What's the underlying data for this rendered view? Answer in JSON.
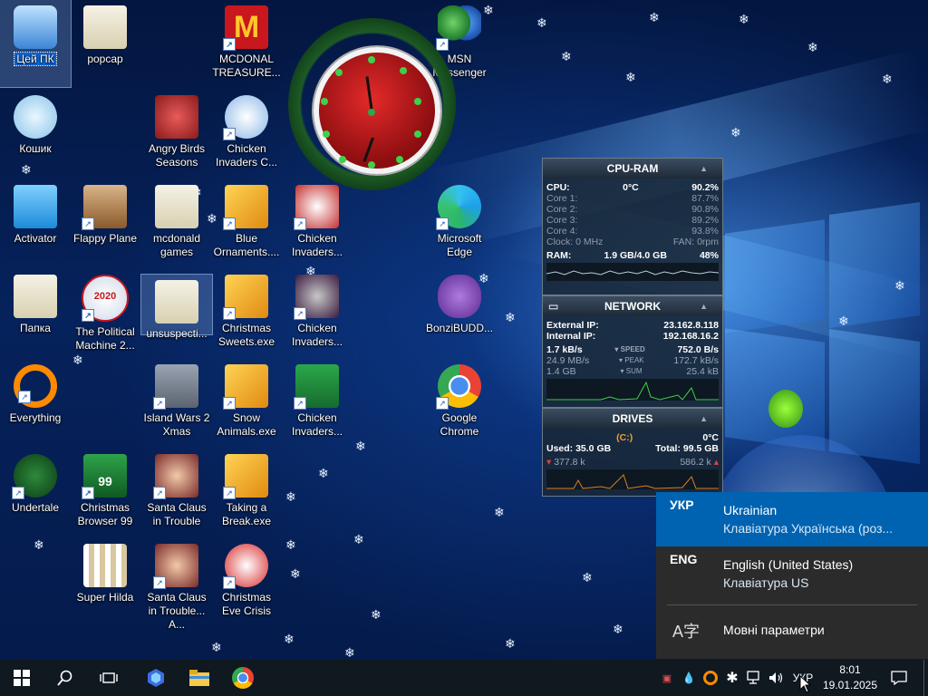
{
  "desktop": {
    "icons": [
      {
        "label": "Цей ПК"
      },
      {
        "label": "popcap"
      },
      {
        "label": "MCDONAL TREASURE..."
      },
      {
        "label": "MSN Messenger"
      },
      {
        "label": "Кошик"
      },
      {
        "label": "Angry Birds Seasons"
      },
      {
        "label": "Chicken Invaders C..."
      },
      {
        "label": "Activator"
      },
      {
        "label": "Flappy Plane"
      },
      {
        "label": "mcdonald games"
      },
      {
        "label": "Blue Ornaments...."
      },
      {
        "label": "Chicken Invaders..."
      },
      {
        "label": "Microsoft Edge"
      },
      {
        "label": "Папка"
      },
      {
        "label": "The Political Machine 2..."
      },
      {
        "label": "unsuspecti..."
      },
      {
        "label": "Christmas Sweets.exe"
      },
      {
        "label": "Chicken Invaders..."
      },
      {
        "label": "BonziBUDD..."
      },
      {
        "label": "Everything"
      },
      {
        "label": "Island Wars 2 Xmas"
      },
      {
        "label": "Snow Animals.exe"
      },
      {
        "label": "Chicken Invaders..."
      },
      {
        "label": "Google Chrome"
      },
      {
        "label": "Undertale"
      },
      {
        "label": "Christmas Browser 99"
      },
      {
        "label": "Santa Claus in Trouble"
      },
      {
        "label": "Taking a Break.exe"
      },
      {
        "label": "Super Hilda"
      },
      {
        "label": "Santa Claus in Trouble... A..."
      },
      {
        "label": "Christmas Eve Crisis"
      }
    ],
    "icon_badges": {
      "political": "2020",
      "browser99": "99"
    }
  },
  "cpu_ram": {
    "title": "CPU-RAM",
    "cpu_label": "CPU:",
    "cpu_temp": "0°C",
    "cpu_value": "90.2%",
    "cores": [
      {
        "label": "Core 1:",
        "value": "87.7%"
      },
      {
        "label": "Core 2:",
        "value": "90.8%"
      },
      {
        "label": "Core 3:",
        "value": "89.2%"
      },
      {
        "label": "Core 4:",
        "value": "93.8%"
      }
    ],
    "clock_label": "Clock: 0 MHz",
    "fan_label": "FAN: 0rpm",
    "ram_label": "RAM:",
    "ram_used": "1.9 GB/4.0 GB",
    "ram_pct": "48%"
  },
  "network": {
    "title": "NETWORK",
    "external_label": "External IP:",
    "external_ip": "23.162.8.118",
    "internal_label": "Internal IP:",
    "internal_ip": "192.168.16.2",
    "speed_down": "1.7 kB/s",
    "speed_label": "SPEED",
    "speed_up": "752.0 B/s",
    "peak_down": "24.9 MB/s",
    "peak_label": "PEAK",
    "peak_up": "172.7 kB/s",
    "sum_down": "1.4 GB",
    "sum_label": "SUM",
    "sum_up": "25.4 kB"
  },
  "drives": {
    "title": "DRIVES",
    "drive": "(C:)",
    "temp": "0°C",
    "used": "Used: 35.0 GB",
    "total": "Total: 99.5 GB",
    "read": "377.8 k",
    "write": "586.2 k"
  },
  "language_flyout": {
    "items": [
      {
        "code": "УКР",
        "name": "Ukrainian",
        "keyboard": "Клавіатура Українська (роз..."
      },
      {
        "code": "ENG",
        "name": "English (United States)",
        "keyboard": "Клавіатура US"
      }
    ],
    "settings_label": "Мовні параметри"
  },
  "taskbar": {
    "lang_indicator": "УКР",
    "time": "8:01",
    "date": "19.01.2025"
  },
  "colors": {
    "flyout_bg": "#2b2b2b",
    "flyout_active": "#0063b1",
    "taskbar_bg": "#101820",
    "gadget_bg": "#192837"
  }
}
